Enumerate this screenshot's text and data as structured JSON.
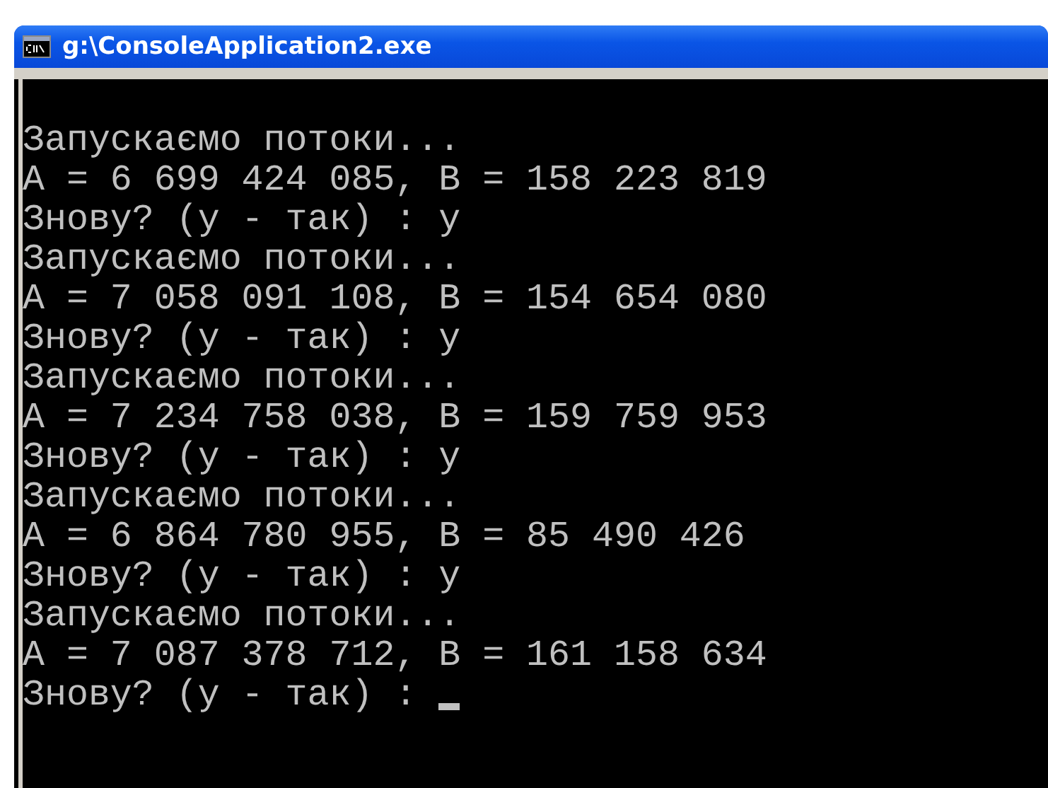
{
  "window": {
    "title": "g:\\ConsoleApplication2.exe"
  },
  "console": {
    "lines": [
      {
        "text": "Запускаємо потоки..."
      },
      {
        "text": "A = 6 699 424 085, B = 158 223 819"
      },
      {
        "text": "Знову? (y - так) : y"
      },
      {
        "text": "Запускаємо потоки..."
      },
      {
        "text": "A = 7 058 091 108, B = 154 654 080"
      },
      {
        "text": "Знову? (y - так) : y"
      },
      {
        "text": "Запускаємо потоки..."
      },
      {
        "text": "A = 7 234 758 038, B = 159 759 953"
      },
      {
        "text": "Знову? (y - так) : y"
      },
      {
        "text": "Запускаємо потоки..."
      },
      {
        "text": "A = 6 864 780 955, B = 85 490 426"
      },
      {
        "text": "Знову? (y - так) : y"
      },
      {
        "text": "Запускаємо потоки..."
      },
      {
        "text": "A = 7 087 378 712, B = 161 158 634"
      },
      {
        "text": "Знову? (y - так) :",
        "cursor": true
      }
    ]
  }
}
